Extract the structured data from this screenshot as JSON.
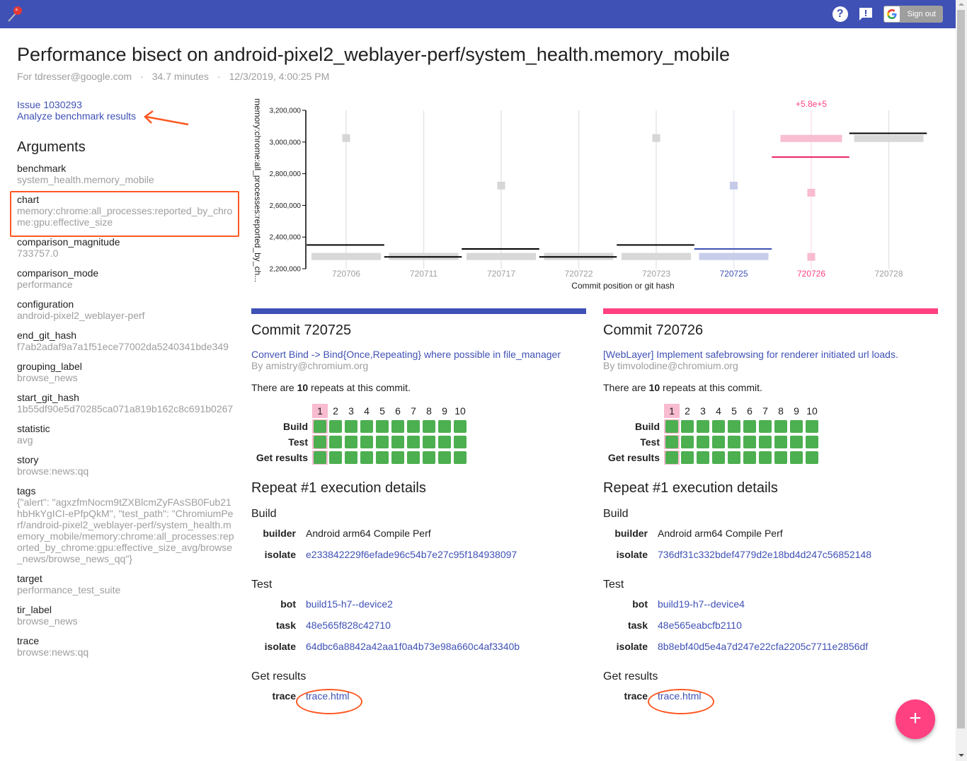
{
  "topbar": {
    "logo_icon": "pushpin-icon",
    "help_icon": "help-icon",
    "feedback_icon": "feedback-icon",
    "signout_label": "Sign out",
    "google_logo": "G"
  },
  "header": {
    "title": "Performance bisect on android-pixel2_weblayer-perf/system_health.memory_mobile",
    "user": "For tdresser@google.com",
    "duration": "34.7 minutes",
    "date": "12/3/2019, 4:00:25 PM",
    "separator": "·"
  },
  "sidebar": {
    "issue_link": "Issue 1030293",
    "analyze_link": "Analyze benchmark results",
    "arguments_title": "Arguments",
    "arguments": [
      {
        "name": "benchmark",
        "value": "system_health.memory_mobile"
      },
      {
        "name": "chart",
        "value": "memory:chrome:all_processes:reported_by_chrome:gpu:effective_size"
      },
      {
        "name": "comparison_magnitude",
        "value": "733757.0"
      },
      {
        "name": "comparison_mode",
        "value": "performance"
      },
      {
        "name": "configuration",
        "value": "android-pixel2_weblayer-perf"
      },
      {
        "name": "end_git_hash",
        "value": "f7ab2adaf9a7a1f51ece77002da5240341bde349"
      },
      {
        "name": "grouping_label",
        "value": "browse_news"
      },
      {
        "name": "start_git_hash",
        "value": "1b55df90e5d70285ca071a819b162c8c691b0267"
      },
      {
        "name": "statistic",
        "value": "avg"
      },
      {
        "name": "story",
        "value": "browse:news:qq"
      },
      {
        "name": "tags",
        "value": "{\"alert\": \"agxzfmNocm9tZXBlcmZyFAsSB0Fub21hbHkYgICI-ePfpQkM\", \"test_path\": \"ChromiumPerf/android-pixel2_weblayer-perf/system_health.memory_mobile/memory:chrome:all_processes:reported_by_chrome:gpu:effective_size_avg/browse_news/browse_news_qq\"}"
      },
      {
        "name": "target",
        "value": "performance_test_suite"
      },
      {
        "name": "tir_label",
        "value": "browse_news"
      },
      {
        "name": "trace",
        "value": "browse:news:qq"
      }
    ]
  },
  "chart_data": {
    "type": "box",
    "ylabel": "memory:chrome:all_processes:reported_by_ch...",
    "xlabel": "Commit position or git hash",
    "ylim": [
      2200000,
      3200000
    ],
    "yticks": [
      "2,200,000",
      "2,400,000",
      "2,600,000",
      "2,800,000",
      "3,000,000",
      "3,200,000"
    ],
    "ytick_values": [
      2200000,
      2400000,
      2600000,
      2800000,
      3000000,
      3200000
    ],
    "annotation": {
      "text": "+5.8e+5",
      "at": "720726",
      "color": "#ff4081"
    },
    "categories": [
      "720706",
      "720711",
      "720717",
      "720722",
      "720723",
      "720725",
      "720726",
      "720728"
    ],
    "series": [
      {
        "commit": "720706",
        "mean": 2350000,
        "box": [
          2255000,
          2300000
        ],
        "outliers": [
          3025000
        ],
        "state": "normal"
      },
      {
        "commit": "720711",
        "mean": 2275000,
        "box": [
          2255000,
          2300000
        ],
        "outliers": [],
        "state": "normal"
      },
      {
        "commit": "720717",
        "mean": 2325000,
        "box": [
          2255000,
          2300000
        ],
        "outliers": [
          2725000
        ],
        "state": "normal"
      },
      {
        "commit": "720722",
        "mean": 2275000,
        "box": [
          2255000,
          2300000
        ],
        "outliers": [],
        "state": "normal"
      },
      {
        "commit": "720723",
        "mean": 2350000,
        "box": [
          2255000,
          2300000
        ],
        "outliers": [
          3025000
        ],
        "state": "normal"
      },
      {
        "commit": "720725",
        "mean": 2325000,
        "box": [
          2255000,
          2300000
        ],
        "outliers": [
          2725000
        ],
        "state": "selected-a"
      },
      {
        "commit": "720726",
        "mean": 2905000,
        "box": [
          3000000,
          3045000
        ],
        "outliers": [
          2680000,
          2275000
        ],
        "state": "selected-b"
      },
      {
        "commit": "720728",
        "mean": 3055000,
        "box": [
          3000000,
          3045000
        ],
        "outliers": [],
        "state": "normal"
      }
    ],
    "colors": {
      "normal": "#d6d6d6",
      "normal_mean": "#000000",
      "a_box": "#c5cae9",
      "a_mean": "#3f51b5",
      "a_label": "#3f51b5",
      "b_box": "#f8bbd0",
      "b_mean": "#e91e63",
      "b_label": "#ff4081",
      "tick_label": "#9e9e9e"
    }
  },
  "commits": [
    {
      "title": "Commit 720725",
      "color": "#3f51b5",
      "message": "Convert Bind -> Bind{Once,Repeating} where possible in file_manager",
      "author": "By amistry@chromium.org",
      "repeats_prefix": "There are ",
      "repeats_count": "10",
      "repeats_suffix": " repeats at this commit.",
      "repeat_numbers": [
        "1",
        "2",
        "3",
        "4",
        "5",
        "6",
        "7",
        "8",
        "9",
        "10"
      ],
      "selected_repeat": 1,
      "rows": [
        "Build",
        "Test",
        "Get results"
      ],
      "exec_title_prefix": "Repeat #",
      "exec_title_num": "1",
      "exec_title_suffix": " execution details",
      "build": {
        "label": "Build",
        "builder_key": "builder",
        "builder": "Android arm64 Compile Perf",
        "isolate_key": "isolate",
        "isolate": "e233842229f6efade96c54b7e27c95f184938097"
      },
      "test": {
        "label": "Test",
        "bot_key": "bot",
        "bot": "build15-h7--device2",
        "task_key": "task",
        "task": "48e565f828c42710",
        "isolate_key": "isolate",
        "isolate": "64dbc6a8842a42aa1f0a4b73e98a660c4af3340b"
      },
      "results": {
        "label": "Get results",
        "trace_key": "trace",
        "trace": "trace.html"
      }
    },
    {
      "title": "Commit 720726",
      "color": "#ff4081",
      "message": "[WebLayer] Implement safebrowsing for renderer initiated url loads.",
      "author": "By timvolodine@chromium.org",
      "repeats_prefix": "There are ",
      "repeats_count": "10",
      "repeats_suffix": " repeats at this commit.",
      "repeat_numbers": [
        "1",
        "2",
        "3",
        "4",
        "5",
        "6",
        "7",
        "8",
        "9",
        "10"
      ],
      "selected_repeat": 1,
      "rows": [
        "Build",
        "Test",
        "Get results"
      ],
      "exec_title_prefix": "Repeat #",
      "exec_title_num": "1",
      "exec_title_suffix": " execution details",
      "build": {
        "label": "Build",
        "builder_key": "builder",
        "builder": "Android arm64 Compile Perf",
        "isolate_key": "isolate",
        "isolate": "736df31c332bdef4779d2e18bd4d247c56852148"
      },
      "test": {
        "label": "Test",
        "bot_key": "bot",
        "bot": "build19-h7--device4",
        "task_key": "task",
        "task": "48e565eabcfb2110",
        "isolate_key": "isolate",
        "isolate": "8b8ebf40d5e4a7d247e22cfa2205c7711e2856df"
      },
      "results": {
        "label": "Get results",
        "trace_key": "trace",
        "trace": "trace.html"
      }
    }
  ],
  "fab": {
    "label": "+",
    "icon": "add-icon"
  }
}
